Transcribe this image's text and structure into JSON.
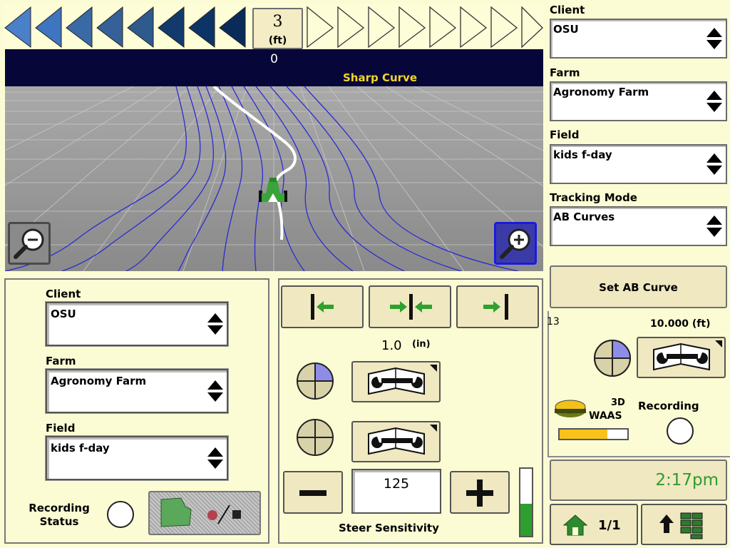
{
  "lightbar": {
    "offset_value": "3",
    "offset_unit": "(ft)"
  },
  "guidance": {
    "track_number": "0",
    "message": "Sharp Curve"
  },
  "right": {
    "client_label": "Client",
    "client_value": "OSU",
    "farm_label": "Farm",
    "farm_value": "Agronomy Farm",
    "field_label": "Field",
    "field_value": "kids f-day",
    "mode_label": "Tracking Mode",
    "mode_value": "AB Curves",
    "set_ab_label": "Set AB Curve",
    "ab_number": "13",
    "ab_width": "10.000 (ft)",
    "gps_mode": "3D",
    "gps_correction": "WAAS",
    "gps_signal_fraction": 0.7,
    "recording_label": "Recording"
  },
  "bottom_left": {
    "client_label": "Client",
    "client_value": "OSU",
    "farm_label": "Farm",
    "farm_value": "Agronomy Farm",
    "field_label": "Field",
    "field_value": "kids f-day",
    "recording_status_line1": "Recording",
    "recording_status_line2": "Status"
  },
  "bottom_mid": {
    "shift_value": "1.0",
    "shift_unit": "(in)",
    "steer_sensitivity_value": "125",
    "steer_sensitivity_label": "Steer Sensitivity",
    "sensitivity_fraction": 0.48
  },
  "footer": {
    "time": "2:17pm",
    "home_page": "1/1"
  },
  "colors": {
    "background": "#fcfcd4",
    "header_bar": "#060638",
    "message": "#f2d62a",
    "guidance_lines": "#2b2bd4",
    "time_text": "#2f9a2f",
    "arrow_green": "#2ea12e"
  }
}
